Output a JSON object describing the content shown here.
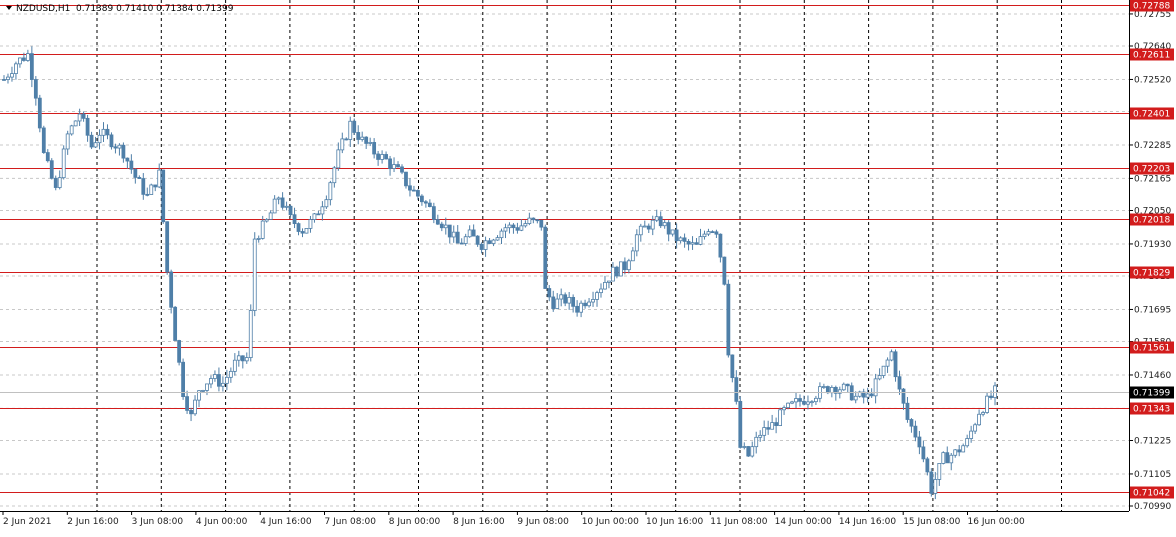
{
  "header": {
    "symbol": "NZDUSD,H1",
    "ohlc": "0.71389 0.71410 0.71384 0.71399"
  },
  "colors": {
    "candle": "#4f7fa8",
    "level": "#d21c1c",
    "grid": "#c8c8c8",
    "axis_text": "#222222",
    "price_tag_bg": "#000000"
  },
  "chart_data": {
    "type": "candlestick",
    "symbol": "NZDUSD",
    "timeframe": "H1",
    "ylim": [
      0.7099,
      0.72805
    ],
    "current_price": 0.71399,
    "price_ticks": [
      "0.72755",
      "0.72640",
      "0.72520",
      "0.72405",
      "0.72285",
      "0.72165",
      "0.72050",
      "0.71930",
      "0.71815",
      "0.71695",
      "0.71580",
      "0.71460",
      "0.71340",
      "0.71225",
      "0.71105",
      "0.70990"
    ],
    "x_labels": [
      "2 Jun 2021",
      "2 Jun 16:00",
      "3 Jun 08:00",
      "4 Jun 00:00",
      "4 Jun 16:00",
      "7 Jun 08:00",
      "8 Jun 00:00",
      "8 Jun 16:00",
      "9 Jun 08:00",
      "10 Jun 00:00",
      "10 Jun 16:00",
      "11 Jun 08:00",
      "14 Jun 00:00",
      "14 Jun 16:00",
      "15 Jun 08:00",
      "16 Jun 00:00"
    ],
    "levels": [
      "0.72788",
      "0.72611",
      "0.72401",
      "0.72203",
      "0.72018",
      "0.71829",
      "0.71561",
      "0.71343",
      "0.71042"
    ],
    "close_anchors": [
      [
        0,
        0.7252
      ],
      [
        3,
        0.7258
      ],
      [
        6,
        0.7261
      ],
      [
        8,
        0.7247
      ],
      [
        10,
        0.7225
      ],
      [
        13,
        0.7212
      ],
      [
        16,
        0.7232
      ],
      [
        19,
        0.724
      ],
      [
        22,
        0.7228
      ],
      [
        24,
        0.7233
      ],
      [
        27,
        0.723
      ],
      [
        30,
        0.7226
      ],
      [
        33,
        0.7217
      ],
      [
        36,
        0.721
      ],
      [
        39,
        0.7218
      ],
      [
        40,
        0.7201
      ],
      [
        41,
        0.7183
      ],
      [
        43,
        0.716
      ],
      [
        45,
        0.714
      ],
      [
        47,
        0.7131
      ],
      [
        49,
        0.7141
      ],
      [
        52,
        0.7145
      ],
      [
        55,
        0.7143
      ],
      [
        58,
        0.715
      ],
      [
        61,
        0.7152
      ],
      [
        62,
        0.7168
      ],
      [
        63,
        0.7195
      ],
      [
        66,
        0.7201
      ],
      [
        69,
        0.721
      ],
      [
        72,
        0.7202
      ],
      [
        75,
        0.7198
      ],
      [
        78,
        0.7202
      ],
      [
        81,
        0.7211
      ],
      [
        84,
        0.7225
      ],
      [
        87,
        0.7236
      ],
      [
        90,
        0.723
      ],
      [
        93,
        0.7226
      ],
      [
        96,
        0.7223
      ],
      [
        99,
        0.7219
      ],
      [
        102,
        0.7213
      ],
      [
        105,
        0.7209
      ],
      [
        108,
        0.7204
      ],
      [
        111,
        0.7199
      ],
      [
        114,
        0.7193
      ],
      [
        117,
        0.7196
      ],
      [
        120,
        0.7193
      ],
      [
        123,
        0.7196
      ],
      [
        126,
        0.7199
      ],
      [
        129,
        0.7199
      ],
      [
        132,
        0.7201
      ],
      [
        135,
        0.72
      ],
      [
        136,
        0.7176
      ],
      [
        138,
        0.7172
      ],
      [
        141,
        0.7173
      ],
      [
        144,
        0.717
      ],
      [
        147,
        0.7174
      ],
      [
        150,
        0.7178
      ],
      [
        153,
        0.7183
      ],
      [
        156,
        0.7185
      ],
      [
        159,
        0.7196
      ],
      [
        162,
        0.72
      ],
      [
        165,
        0.7201
      ],
      [
        168,
        0.7196
      ],
      [
        171,
        0.7193
      ],
      [
        174,
        0.7192
      ],
      [
        177,
        0.7199
      ],
      [
        179,
        0.7198
      ],
      [
        181,
        0.718
      ],
      [
        182,
        0.7155
      ],
      [
        184,
        0.7135
      ],
      [
        185,
        0.712
      ],
      [
        187,
        0.7117
      ],
      [
        190,
        0.7125
      ],
      [
        193,
        0.7128
      ],
      [
        196,
        0.7133
      ],
      [
        199,
        0.7136
      ],
      [
        202,
        0.7138
      ],
      [
        205,
        0.714
      ],
      [
        208,
        0.7142
      ],
      [
        211,
        0.7141
      ],
      [
        214,
        0.7138
      ],
      [
        217,
        0.7138
      ],
      [
        220,
        0.7145
      ],
      [
        223,
        0.7154
      ],
      [
        225,
        0.714
      ],
      [
        227,
        0.713
      ],
      [
        230,
        0.7122
      ],
      [
        233,
        0.7105
      ],
      [
        236,
        0.7116
      ],
      [
        239,
        0.7118
      ],
      [
        242,
        0.7122
      ],
      [
        245,
        0.7133
      ],
      [
        248,
        0.7138
      ],
      [
        249,
        0.71399
      ]
    ]
  }
}
